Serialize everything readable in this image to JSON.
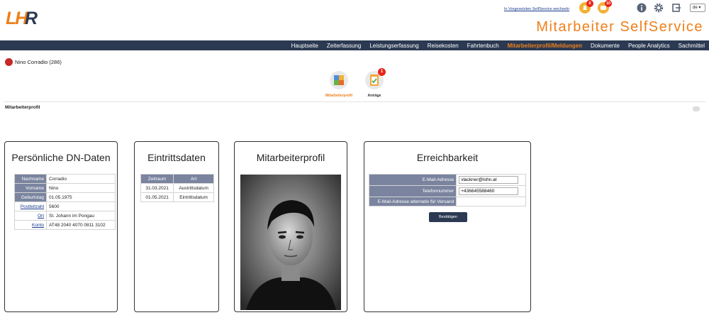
{
  "header": {
    "logo_text": "LHR",
    "switch_link": "In Vorgesetzten SelfService wechseln",
    "notifications": [
      {
        "icon": "notification-bell-icon",
        "count": "6"
      },
      {
        "icon": "message-icon",
        "count": "10"
      }
    ],
    "language": "de",
    "app_title": "Mitarbeiter SelfService"
  },
  "nav": {
    "items": [
      "Hauptseite",
      "Zeiterfassung",
      "Leistungserfassung",
      "Reisekosten",
      "Fahrtenbuch",
      "Mitarbeiterprofil/Meldungen",
      "Dokumente",
      "People Analytics",
      "Sachmittel"
    ],
    "active_index": 5,
    "active_color": "#ee7f1a"
  },
  "user": {
    "name": "Nino Corradio (286)"
  },
  "tiles": [
    {
      "label": "Mitarbeiterprofil",
      "icon": "profile-puzzle-icon",
      "active": true
    },
    {
      "label": "Anträge",
      "icon": "clipboard-check-icon",
      "badge": "1"
    }
  ],
  "section_title": "Mitarbeiterprofil",
  "personal": {
    "title": "Persönliche DN-Daten",
    "rows": [
      {
        "label": "Nachname",
        "value": "Corradio"
      },
      {
        "label": "Vorname",
        "value": "Nino"
      },
      {
        "label": "Geburtstag",
        "value": "01.05.1975"
      },
      {
        "label": "Postleitzahl",
        "value": "5600"
      },
      {
        "label": "Ort",
        "value": "St. Johann im Pongau"
      },
      {
        "label": "Konto",
        "value": "AT48 2040 4070 0811 3102"
      }
    ]
  },
  "entry": {
    "title": "Eintrittsdaten",
    "headers": [
      "Zeitraum",
      "Art"
    ],
    "rows": [
      [
        "31.03.2021",
        "Austrittsdatum"
      ],
      [
        "01.05.2021",
        "Eintrittsdatum"
      ]
    ]
  },
  "profile": {
    "title": "Mitarbeiterprofil"
  },
  "contact": {
    "title": "Erreichbarkeit",
    "email_label": "E-Mail-Adresse",
    "email_value": "vlackner@lohn.at",
    "phone_label": "Telefonnummer",
    "phone_value": "+436645588460",
    "alt_email_label": "E-Mail-Adresse alternativ für Versand",
    "confirm_label": "Bestätigen"
  },
  "colors": {
    "brand_orange": "#ee7f1a",
    "navbar": "#2b3a52",
    "table_header": "#7a849f",
    "badge_red": "#e8231b"
  }
}
